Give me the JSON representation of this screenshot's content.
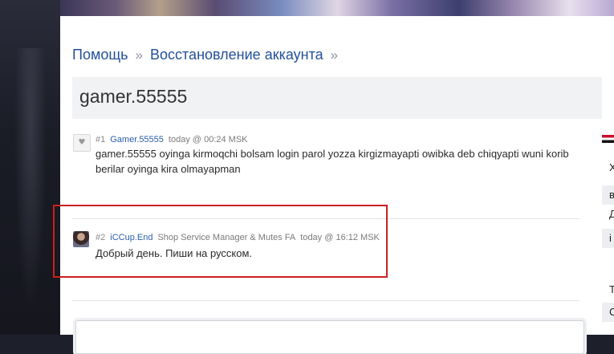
{
  "breadcrumb": {
    "items": [
      "Помощь",
      "Восстановление аккаунта"
    ],
    "separator": "»"
  },
  "topic": {
    "title": "gamer.55555"
  },
  "posts": [
    {
      "number": "#1",
      "author": "Gamer.55555",
      "role": "",
      "time": "today @ 00:24 MSK",
      "body": "gamer.55555 oyinga kirmoqchi bolsam login parol yozza kirgizmayapti owibka deb chiqyapti wuni korib berilar oyinga kira olmayapman"
    },
    {
      "number": "#2",
      "author": "iCCup.End",
      "role": "Shop Service Manager & Mutes FA",
      "time": "today @ 16:12 MSK",
      "body": "Добрый день. Пиши на русском."
    }
  ],
  "sidebar": {
    "items": [
      "Х",
      "в",
      "Д",
      "i",
      "Т",
      "С"
    ]
  },
  "colors": {
    "link": "#23509a",
    "highlight": "#cc1f1f"
  }
}
